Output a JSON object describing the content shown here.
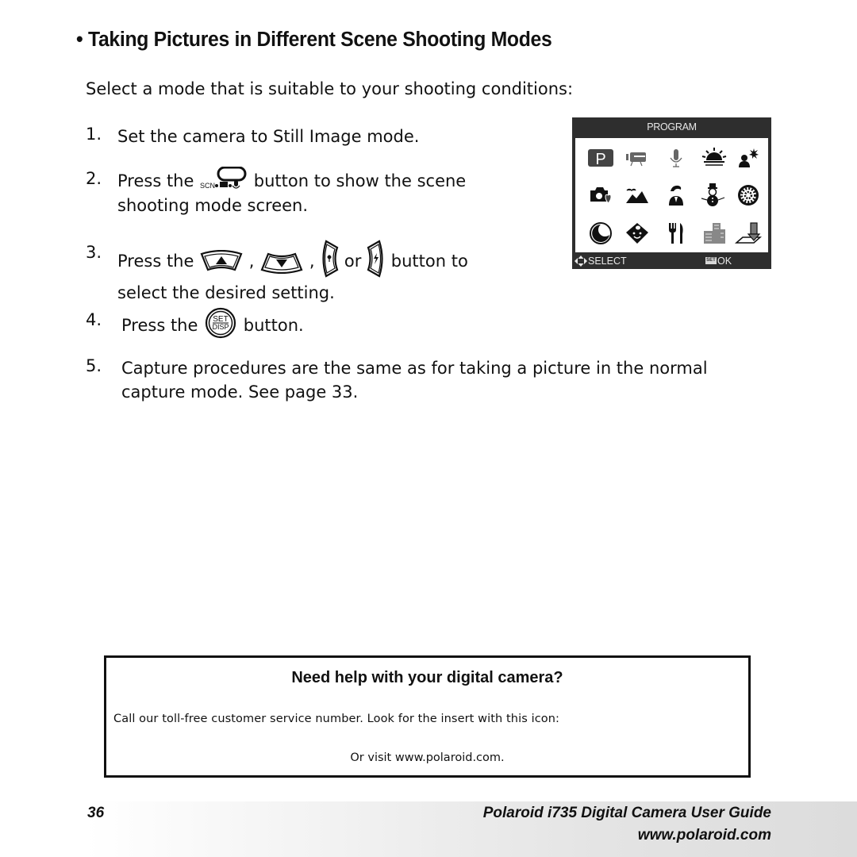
{
  "heading": {
    "bullet": "•",
    "title": "Taking Pictures in Different Scene Shooting Modes"
  },
  "intro": "Select a mode that is suitable to your shooting conditions:",
  "steps": [
    {
      "num": "1.",
      "text": "Set the camera to Still Image mode."
    },
    {
      "num": "2.",
      "pre": "Press the",
      "icon": "scn-movie-voice-button-icon",
      "post": "button to show the scene",
      "line2": "shooting mode screen."
    },
    {
      "num": "3.",
      "pre": "Press the",
      "sep1": ",",
      "sep2": ",",
      "or": "or",
      "post": "button to",
      "line2": "select the desired setting."
    },
    {
      "num": "4.",
      "pre": "Press the",
      "post": "button."
    },
    {
      "num": "5.",
      "text": "Capture procedures are the same as for taking a picture in the normal",
      "line2": "capture mode. See page 33."
    }
  ],
  "button_icons": {
    "scn": "SCN",
    "set": "SET",
    "disp": "DISP"
  },
  "camera_screen": {
    "header": "PROGRAM",
    "select_label": "SELECT",
    "ok_label": "OK",
    "set_badge": "SET",
    "modes": [
      {
        "icon": "program-icon",
        "label": "P",
        "selected": true
      },
      {
        "icon": "movie-icon"
      },
      {
        "icon": "voice-record-icon"
      },
      {
        "icon": "sunset-icon"
      },
      {
        "icon": "backlight-portrait-icon"
      },
      {
        "icon": "camera-heart-icon"
      },
      {
        "icon": "landscape-icon"
      },
      {
        "icon": "portrait-icon"
      },
      {
        "icon": "snowman-icon"
      },
      {
        "icon": "fireworks-icon"
      },
      {
        "icon": "night-icon"
      },
      {
        "icon": "kids-icon"
      },
      {
        "icon": "food-icon"
      },
      {
        "icon": "building-icon"
      },
      {
        "icon": "text-document-icon"
      }
    ]
  },
  "help_box": {
    "title": "Need help with your digital camera?",
    "line1": "Call our toll-free customer service number. Look for the insert with this icon:",
    "line2": "Or visit www.polaroid.com."
  },
  "footer": {
    "page_number": "36",
    "guide_title": "Polaroid i735 Digital Camera User Guide",
    "url": "www.polaroid.com"
  }
}
